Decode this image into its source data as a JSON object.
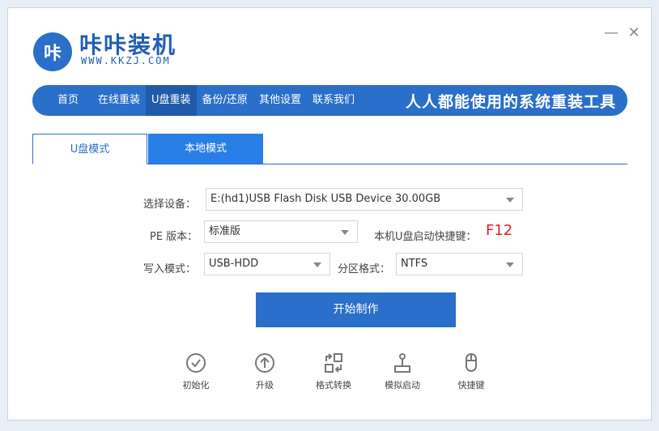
{
  "app": {
    "logo_text": "咔",
    "brand_name": "咔咔装机",
    "brand_url": "WWW.KKZJ.COM",
    "minimize": "—",
    "close": "✕"
  },
  "nav": {
    "items": [
      "首页",
      "在线重装",
      "U盘重装",
      "备份/还原",
      "其他设置",
      "联系我们"
    ],
    "active_index": 2,
    "slogan": "人人都能使用的系统重装工具"
  },
  "tabs": [
    "U盘模式",
    "本地模式"
  ],
  "form": {
    "device_label": "选择设备：",
    "device_value": "E:(hd1)USB Flash Disk USB Device 30.00GB",
    "pe_label": "PE 版本：",
    "pe_value": "标准版",
    "hotkey_label": "本机U盘启动快捷键：",
    "hotkey_value": "F12",
    "write_label": "写入模式：",
    "write_value": "USB-HDD",
    "partition_label": "分区格式：",
    "partition_value": "NTFS"
  },
  "start_button": "开始制作",
  "tools": [
    {
      "label": "初始化",
      "icon": "check-circle-icon"
    },
    {
      "label": "升级",
      "icon": "arrow-up-circle-icon"
    },
    {
      "label": "格式转换",
      "icon": "convert-icon"
    },
    {
      "label": "模拟启动",
      "icon": "joystick-icon"
    },
    {
      "label": "快捷键",
      "icon": "mouse-icon"
    }
  ],
  "colors": {
    "primary": "#2a6fc9",
    "tab_active": "#2a7fe6",
    "hotkey": "#e02020"
  }
}
